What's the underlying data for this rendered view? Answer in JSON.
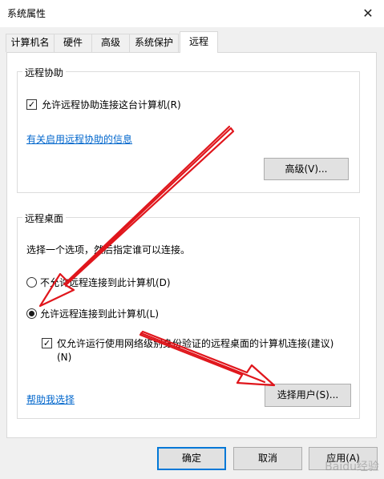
{
  "window": {
    "title": "系统属性"
  },
  "tabs": [
    {
      "label": "计算机名"
    },
    {
      "label": "硬件"
    },
    {
      "label": "高级"
    },
    {
      "label": "系统保护"
    },
    {
      "label": "远程",
      "active": true
    }
  ],
  "remote_assistance": {
    "title": "远程协助",
    "allow_label": "允许远程协助连接这台计算机(R)",
    "allow_checked": true,
    "info_link": "有关启用远程协助的信息",
    "advanced_button": "高级(V)..."
  },
  "remote_desktop": {
    "title": "远程桌面",
    "instruction": "选择一个选项，然后指定谁可以连接。",
    "options": [
      {
        "label": "不允许远程连接到此计算机(D)",
        "selected": false
      },
      {
        "label": "允许远程连接到此计算机(L)",
        "selected": true
      }
    ],
    "nla_label_line1": "仅允许运行使用网络级别身份验证的远程桌面的计算机连接(建议)",
    "nla_label_line2": "(N)",
    "nla_checked": true,
    "help_link": "帮助我选择",
    "select_users_button": "选择用户(S)..."
  },
  "footer": {
    "ok": "确定",
    "cancel": "取消",
    "apply": "应用(A)"
  },
  "icons": {
    "close": "close-icon",
    "check": "checkmark-icon"
  },
  "colors": {
    "link": "#0066cc",
    "annotation_arrow": "#e0161c",
    "default_button_border": "#0078d7"
  },
  "watermark": "Baidu经验"
}
